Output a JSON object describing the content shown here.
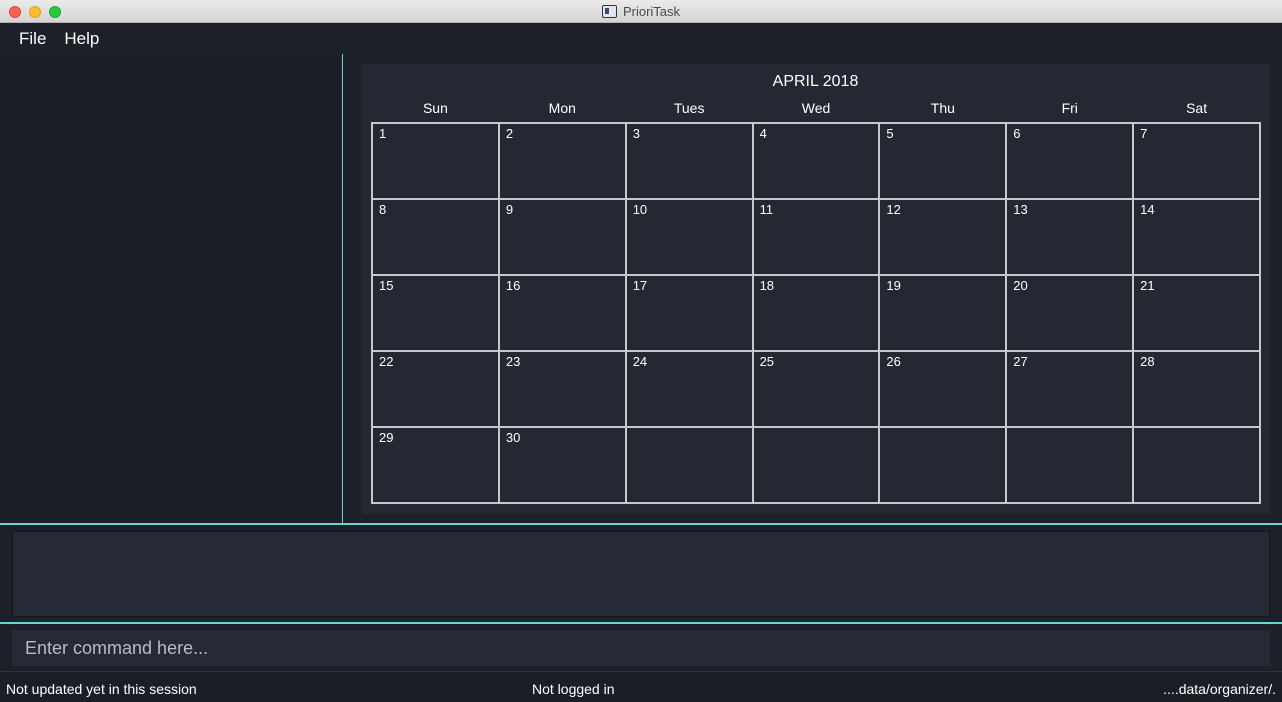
{
  "window": {
    "title": "PrioriTask"
  },
  "menu": {
    "file": "File",
    "help": "Help"
  },
  "calendar": {
    "month_title": "APRIL 2018",
    "weekdays": [
      "Sun",
      "Mon",
      "Tues",
      "Wed",
      "Thu",
      "Fri",
      "Sat"
    ],
    "days": [
      "1",
      "2",
      "3",
      "4",
      "5",
      "6",
      "7",
      "8",
      "9",
      "10",
      "11",
      "12",
      "13",
      "14",
      "15",
      "16",
      "17",
      "18",
      "19",
      "20",
      "21",
      "22",
      "23",
      "24",
      "25",
      "26",
      "27",
      "28",
      "29",
      "30",
      "",
      "",
      "",
      "",
      ""
    ]
  },
  "command": {
    "placeholder": "Enter command here...",
    "value": ""
  },
  "status": {
    "sync": "Not updated yet in this session",
    "login": "Not logged in",
    "path": "....data/organizer/."
  },
  "colors": {
    "accent": "#6ad3d3",
    "background": "#1f212a",
    "panel": "#252a36"
  }
}
